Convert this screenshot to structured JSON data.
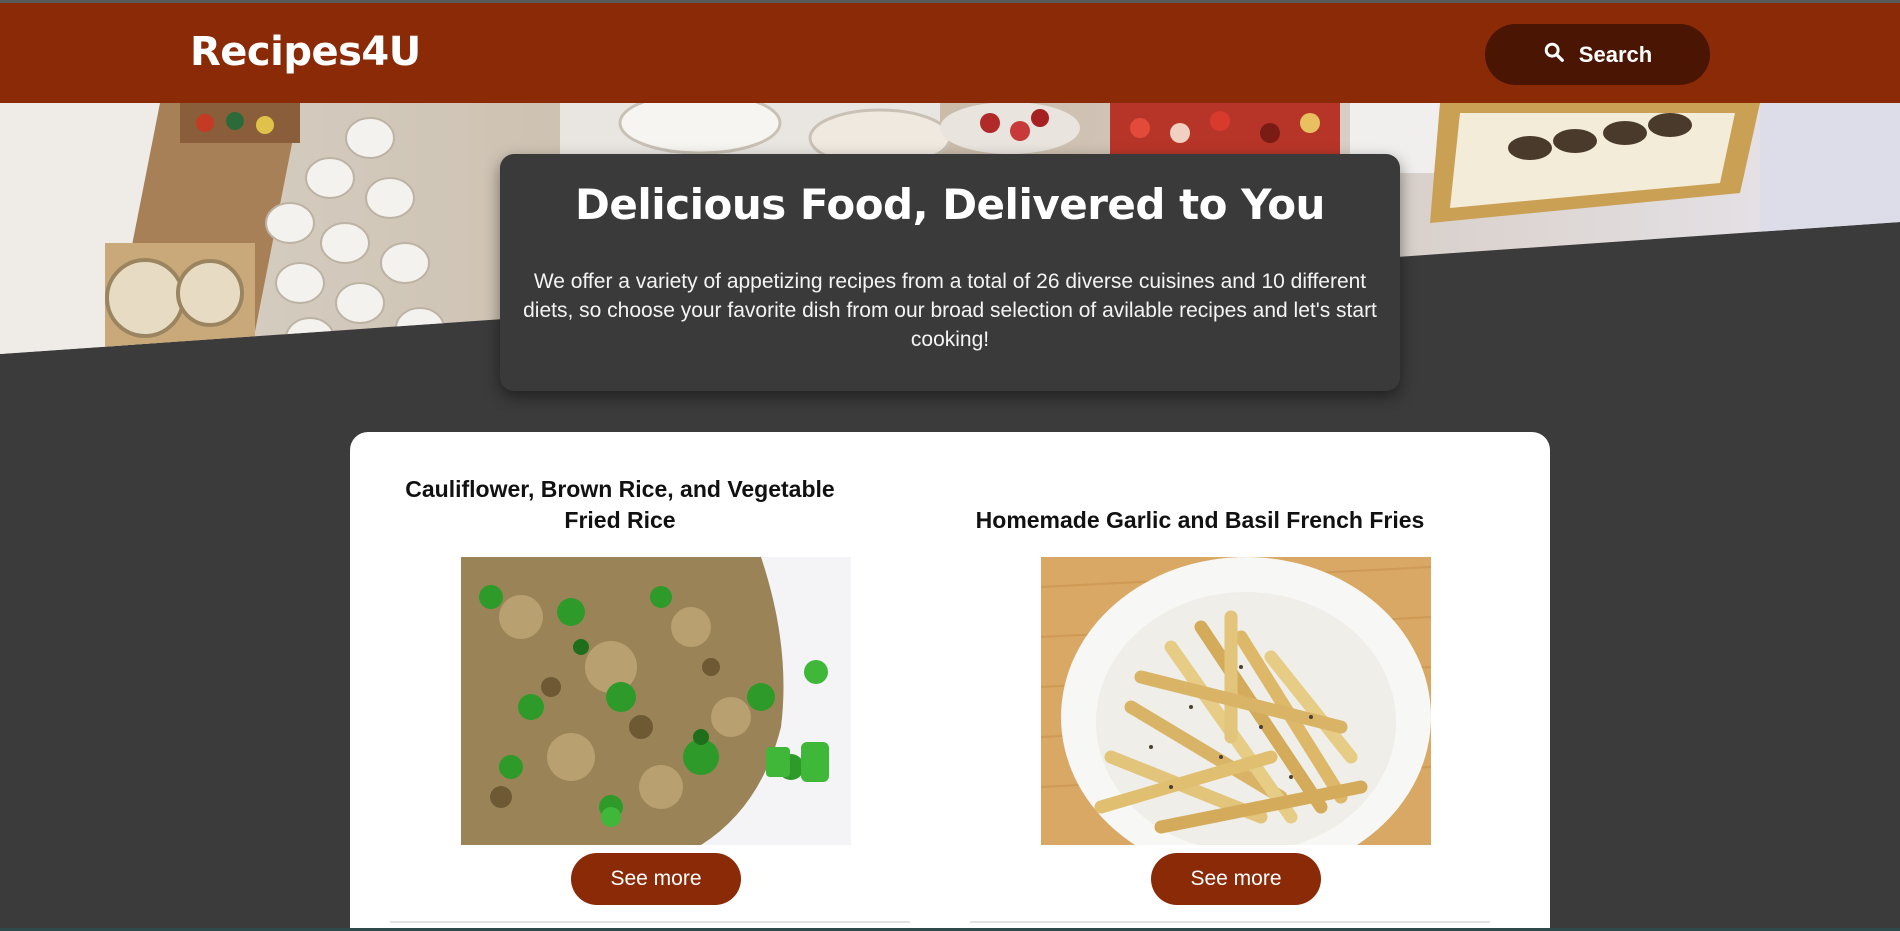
{
  "header": {
    "brand": "Recipes4U",
    "search_label": "Search"
  },
  "intro": {
    "title": "Delicious Food, Delivered to You",
    "text": "We offer a variety of appetizing recipes from a total of 26 diverse cuisines and 10 different diets, so choose your favorite dish from our broad selection of avilable recipes and let's start cooking!"
  },
  "recipes": [
    {
      "title": "Cauliflower, Brown Rice, and Vegetable Fried Rice",
      "button": "See more"
    },
    {
      "title": "Homemade Garlic and Basil French Fries",
      "button": "See more"
    }
  ],
  "icons": {
    "search": "search-icon"
  },
  "colors": {
    "accent": "#8b2a06",
    "accent_dark": "#4a1503",
    "background": "#3b3b3b",
    "panel": "#ffffff"
  }
}
